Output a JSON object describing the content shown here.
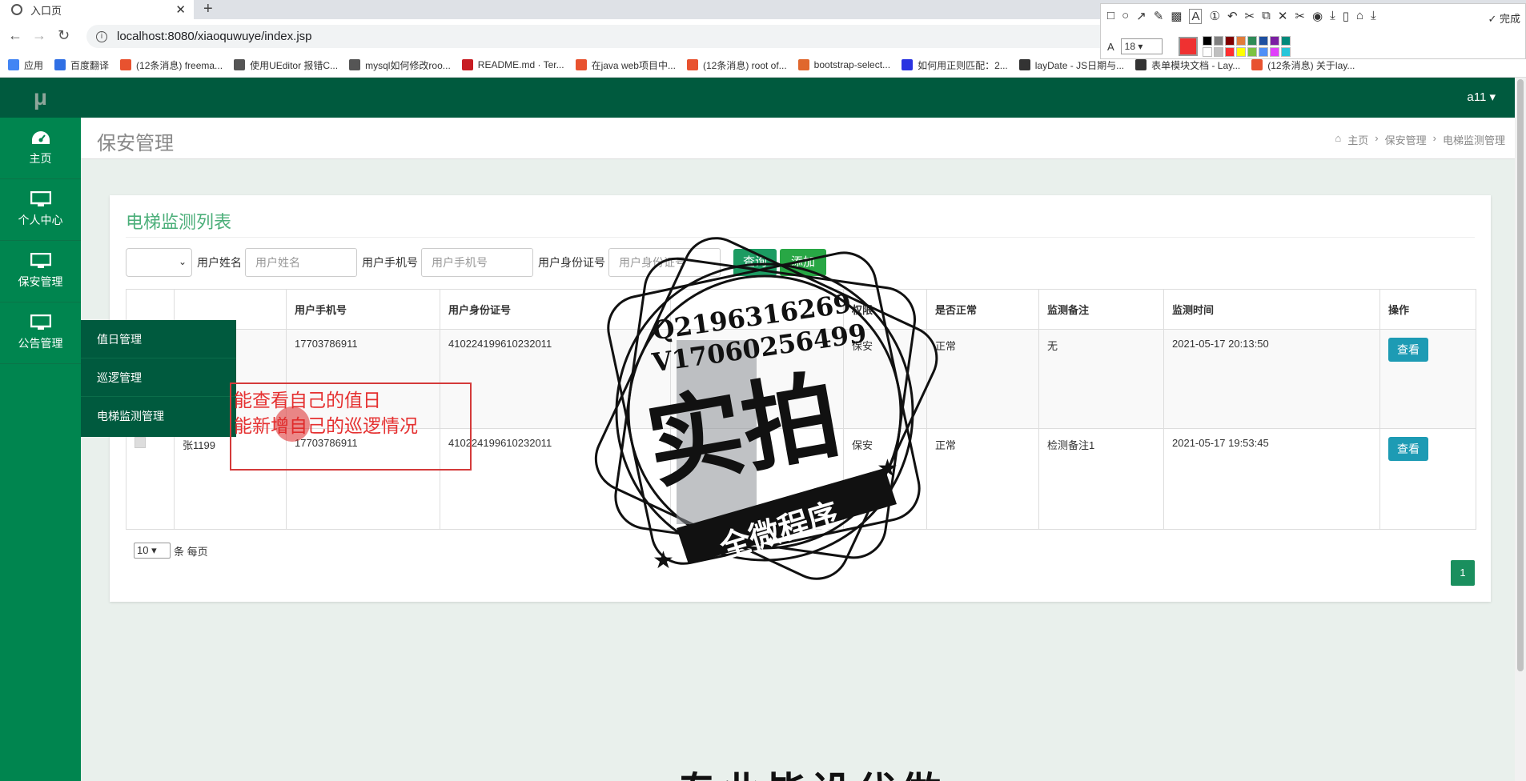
{
  "browser": {
    "tab_title": "入口页",
    "tab_close": "✕",
    "new_tab": "+",
    "url": "localhost:8080/xiaoquwuye/index.jsp",
    "bookmarks": [
      {
        "label": "应用",
        "color": "#4285f4"
      },
      {
        "label": "百度翻译",
        "color": "#2f6fe4"
      },
      {
        "label": "(12条消息) freema...",
        "color": "#e8522f"
      },
      {
        "label": "使用UEditor 报错C...",
        "color": "#555555"
      },
      {
        "label": "mysql如何修改roo...",
        "color": "#555555"
      },
      {
        "label": "README.md · Ter...",
        "color": "#c71d23"
      },
      {
        "label": "在java web项目中...",
        "color": "#e8522f"
      },
      {
        "label": "(12条消息) root of...",
        "color": "#e8522f"
      },
      {
        "label": "bootstrap-select...",
        "color": "#e0672d"
      },
      {
        "label": "如何用正则匹配：2...",
        "color": "#2932e1"
      },
      {
        "label": "layDate - JS日期与...",
        "color": "#333333"
      },
      {
        "label": "表单模块文档 - Lay...",
        "color": "#333333"
      },
      {
        "label": "(12条消息) 关于lay...",
        "color": "#e8522f"
      }
    ]
  },
  "annotation_toolbar": {
    "done_label": "✓ 完成",
    "font_size": "18",
    "current_color": "#ef3131",
    "palette": [
      "#000000",
      "#808080",
      "#800000",
      "#e07b39",
      "#2e8b57",
      "#1e4fa0",
      "#7b1fa2",
      "#00897b",
      "#ffffff",
      "#c0c0c0",
      "#ff3030",
      "#ffff00",
      "#7cc242",
      "#4f8ff7",
      "#e040fb",
      "#26c6da"
    ]
  },
  "app": {
    "brand": "μ",
    "user": "a11 ▾",
    "sidebar": [
      {
        "label": "主页"
      },
      {
        "label": "个人中心"
      },
      {
        "label": "保安管理"
      },
      {
        "label": "公告管理"
      }
    ],
    "flyout": [
      "值日管理",
      "巡逻管理",
      "电梯监测管理"
    ],
    "page_title": "保安管理",
    "breadcrumbs": [
      "主页",
      "保安管理",
      "电梯监测管理"
    ],
    "panel_title": "电梯监测列表",
    "filters": {
      "name_label": "用户姓名",
      "name_placeholder": "用户姓名",
      "phone_label": "用户手机号",
      "phone_placeholder": "用户手机号",
      "id_label": "用户身份证号",
      "id_placeholder": "用户身份证号",
      "query": "查询",
      "add": "添加"
    },
    "table": {
      "headers": [
        "",
        "",
        "用户手机号",
        "用户身份证号",
        "",
        "权限",
        "是否正常",
        "监测备注",
        "监测时间",
        "操作"
      ],
      "rows": [
        {
          "name": "",
          "phone": "17703786911",
          "idcard": "410224199610232011",
          "role": "保安",
          "normal": "正常",
          "note": "无",
          "time": "2021-05-17 20:13:50",
          "action": "查看"
        },
        {
          "name": "张1199",
          "phone": "17703786911",
          "idcard": "410224199610232011",
          "role": "保安",
          "normal": "正常",
          "note": "检测备注1",
          "time": "2021-05-17 19:53:45",
          "action": "查看"
        }
      ]
    },
    "pager": {
      "page_size": "10",
      "suffix": "条 每页",
      "current_page": "1"
    }
  },
  "overlay": {
    "note_line1": "能查看自己的值日",
    "note_line2": "能新增自己的巡逻情况",
    "stamp_line1": "Q2196316269",
    "stamp_line2": "V17060256499",
    "stamp_big": "实拍",
    "stamp_banner": "全微程序",
    "bottom_text": "专业毕设代做"
  }
}
